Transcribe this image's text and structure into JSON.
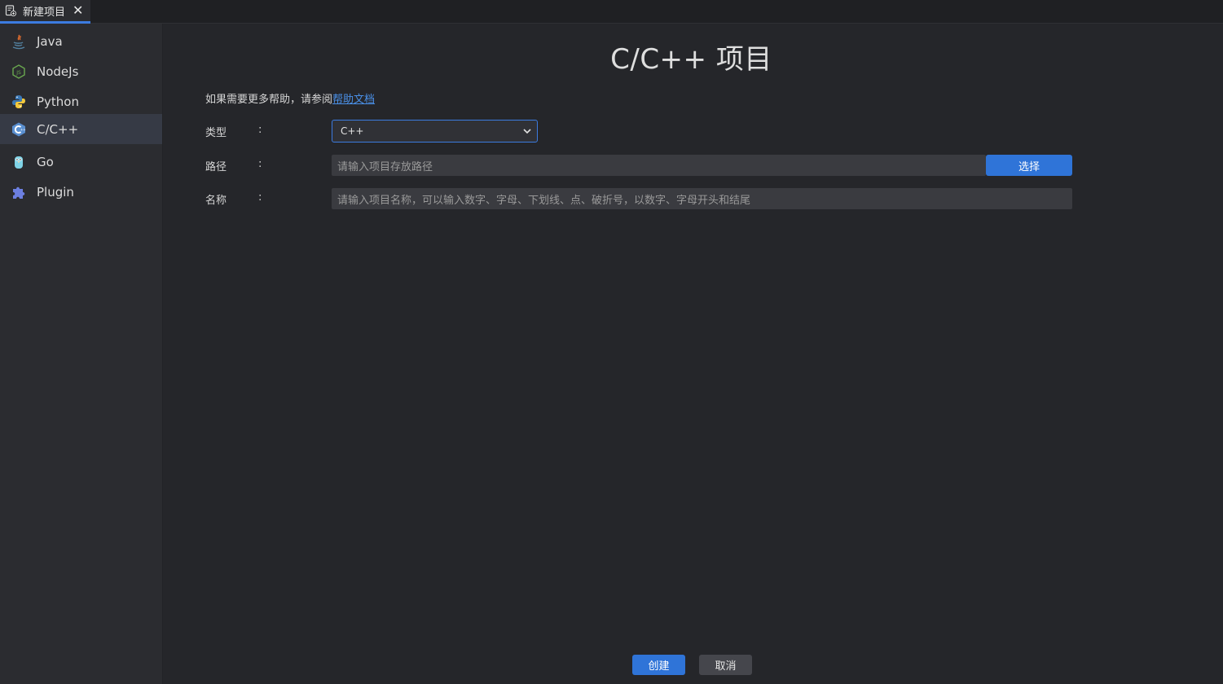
{
  "tab": {
    "label": "新建项目",
    "close": "✕"
  },
  "sidebar": {
    "items": [
      {
        "label": "Java",
        "icon": "java-icon"
      },
      {
        "label": "NodeJs",
        "icon": "nodejs-icon"
      },
      {
        "label": "Python",
        "icon": "python-icon"
      },
      {
        "label": "C/C++",
        "icon": "cpp-icon",
        "active": true
      },
      {
        "label": "Go",
        "icon": "go-icon"
      },
      {
        "label": "Plugin",
        "icon": "plugin-icon"
      }
    ]
  },
  "main": {
    "title": "C/C++ 项目",
    "help_text": "如果需要更多帮助，请参阅",
    "help_link": "帮助文档",
    "fields": {
      "type_label": "类型",
      "type_value": "C++",
      "path_label": "路径",
      "path_placeholder": "请输入项目存放路径",
      "name_label": "名称",
      "name_placeholder": "请输入项目名称，可以输入数字、字母、下划线、点、破折号，以数字、字母开头和结尾",
      "colon": ":"
    },
    "select_button": "选择",
    "create_button": "创建",
    "cancel_button": "取消"
  },
  "colors": {
    "accent": "#2f74d8",
    "background": "#25262a",
    "sidebar": "#2b2c30"
  }
}
